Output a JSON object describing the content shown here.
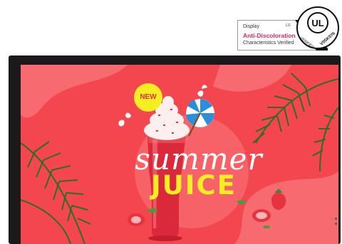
{
  "badge": {
    "line1": "Display",
    "line2": "Anti-Discoloration",
    "line3": "Characteristics Verified",
    "brand_mark": "LG",
    "seal_text": "UL",
    "seal_ring_left": "VERIFIED",
    "seal_ring_right": "V0SK076"
  },
  "screen": {
    "tag": "NEW",
    "title_script": "summer",
    "title_bold": "JUICE"
  },
  "colors": {
    "background_red": "#f3464e",
    "accent_yellow": "#f6ee22",
    "badge_pink": "#d7265a",
    "bezel": "#1a1a1a"
  }
}
